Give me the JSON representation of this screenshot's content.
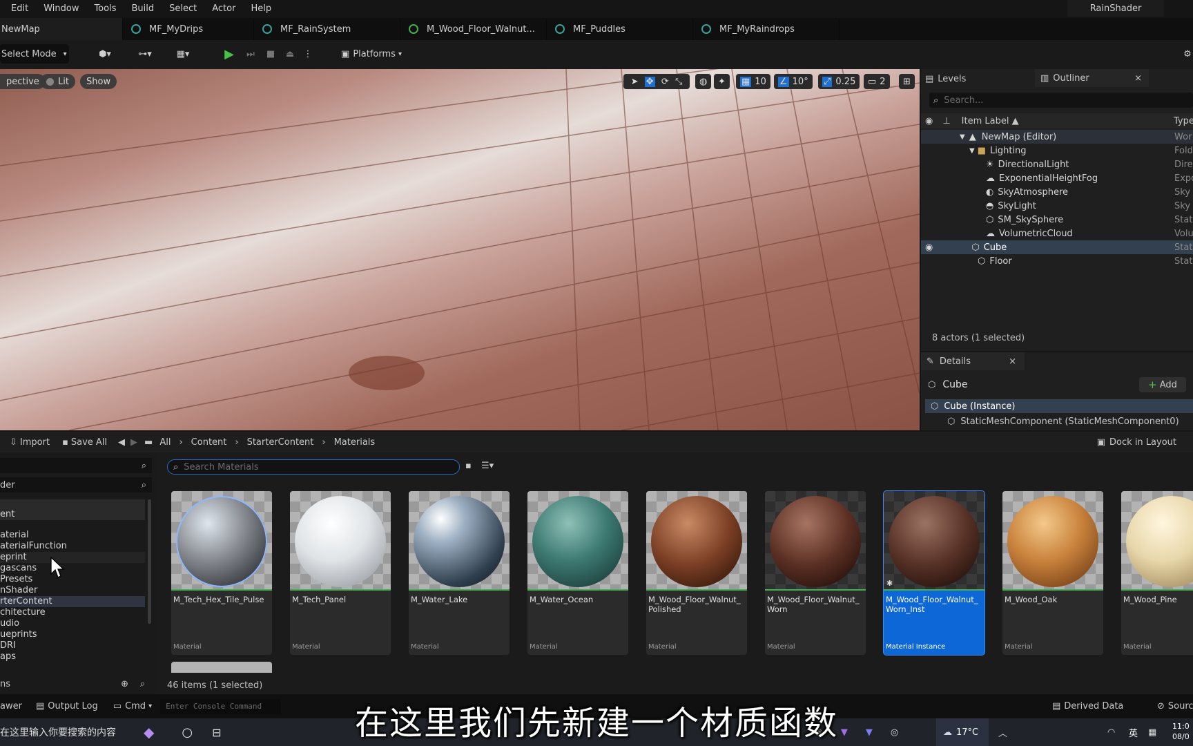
{
  "menu": [
    "Edit",
    "Window",
    "Tools",
    "Build",
    "Select",
    "Actor",
    "Help"
  ],
  "project_name": "RainShader",
  "tabs": [
    {
      "label": "NewMap",
      "active": true
    },
    {
      "label": "MF_MyDrips"
    },
    {
      "label": "MF_RainSystem"
    },
    {
      "label": "M_Wood_Floor_Walnut..."
    },
    {
      "label": "MF_Puddles"
    },
    {
      "label": "MF_MyRaindrops"
    }
  ],
  "toolbar": {
    "select_mode": "Select Mode",
    "platforms": "Platforms"
  },
  "viewport": {
    "perspective": "pective",
    "lit": "Lit",
    "show": "Show",
    "grid_snap": "10",
    "rotation_snap": "10°",
    "scale_snap": "0.25",
    "camera_speed": "2"
  },
  "outliner": {
    "levels_tab": "Levels",
    "outliner_tab": "Outliner",
    "search_placeholder": "Search...",
    "col_label": "Item Label ▲",
    "col_type": "Type",
    "items": [
      {
        "label": "NewMap (Editor)",
        "type": "Wor"
      },
      {
        "label": "Lighting",
        "type": "Fold"
      },
      {
        "label": "DirectionalLight",
        "type": "Dire"
      },
      {
        "label": "ExponentialHeightFog",
        "type": "Expo"
      },
      {
        "label": "SkyAtmosphere",
        "type": "Sky"
      },
      {
        "label": "SkyLight",
        "type": "Sky"
      },
      {
        "label": "SM_SkySphere",
        "type": "Stat"
      },
      {
        "label": "VolumetricCloud",
        "type": "Volu"
      },
      {
        "label": "Cube",
        "type": "Stat"
      },
      {
        "label": "Floor",
        "type": "Stat"
      }
    ],
    "status": "8 actors (1 selected)"
  },
  "details": {
    "tab": "Details",
    "object": "Cube",
    "add": "Add",
    "instance": "Cube (Instance)",
    "component": "StaticMeshComponent (StaticMeshComponent0)"
  },
  "content_browser": {
    "import": "Import",
    "save_all": "Save All",
    "breadcrumb": [
      "All",
      "Content",
      "StarterContent",
      "Materials"
    ],
    "dock": "Dock in Layout",
    "search_placeholder": "Search Materials",
    "left_search_label": "der",
    "folders": [
      "ent",
      "aterial",
      "aterialFunction",
      "eprint",
      "gascans",
      "Presets",
      "nShader",
      "rterContent",
      "chitecture",
      "udio",
      "ueprints",
      "DRI",
      "aps"
    ],
    "assets": [
      {
        "name": "M_Tech_Hex_Tile_Pulse",
        "type": "Material"
      },
      {
        "name": "M_Tech_Panel",
        "type": "Material"
      },
      {
        "name": "M_Water_Lake",
        "type": "Material"
      },
      {
        "name": "M_Water_Ocean",
        "type": "Material"
      },
      {
        "name": "M_Wood_Floor_Walnut_ Polished",
        "type": "Material"
      },
      {
        "name": "M_Wood_Floor_Walnut_ Worn",
        "type": "Material"
      },
      {
        "name": "M_Wood_Floor_Walnut_ Worn_Inst",
        "type": "Material Instance"
      },
      {
        "name": "M_Wood_Oak",
        "type": "Material"
      },
      {
        "name": "M_Wood_Pine",
        "type": "Material"
      }
    ],
    "item_count": "46 items (1 selected)",
    "collections_label": "ns"
  },
  "statusbar": {
    "drawer": "awer",
    "output_log": "Output Log",
    "cmd": "Cmd",
    "console_placeholder": "Enter Console Command",
    "derived_data": "Derived Data",
    "source": "Sourc"
  },
  "subtitle": "在这里我们先新建一个材质函数",
  "taskbar": {
    "search": "在这里输入你要搜索的内容",
    "weather": "17°C",
    "lang": "英",
    "time": "11:0",
    "date": "08/0"
  }
}
